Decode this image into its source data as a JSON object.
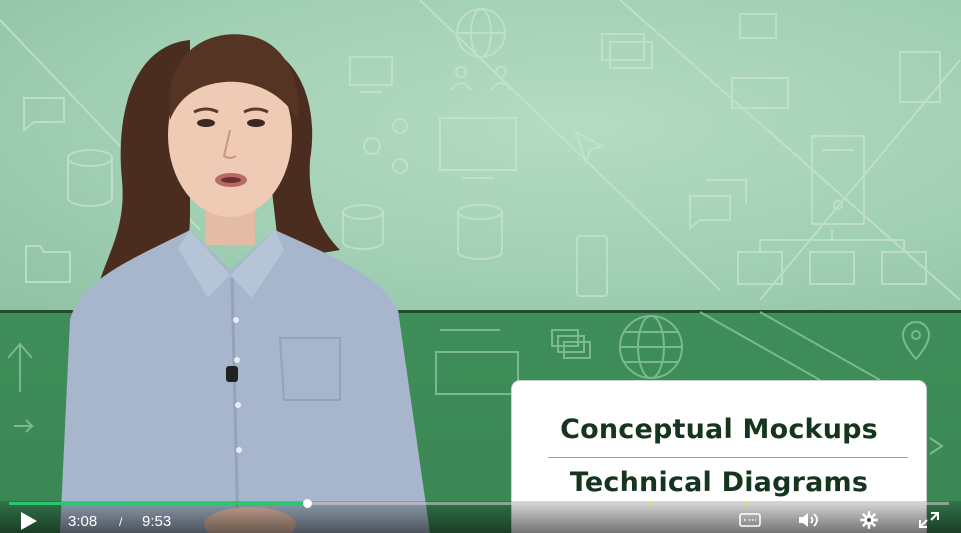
{
  "video": {
    "overlay_lines": [
      "Conceptual Mockups",
      "Technical Diagrams"
    ],
    "colors": {
      "upper_background": "#a6d3b7",
      "lower_band": "#3c8a57",
      "card_text": "#16351f",
      "progress_played": "#2cc46e",
      "chapter_marker": "#e6e23a"
    }
  },
  "controls": {
    "current_time": "3:08",
    "separator": "/",
    "duration": "9:53",
    "progress": 0.317,
    "chapter_markers": [
      0.681,
      0.783
    ],
    "icons": [
      "play-icon",
      "captions-icon",
      "volume-icon",
      "settings-gear-icon",
      "fullscreen-icon"
    ]
  }
}
